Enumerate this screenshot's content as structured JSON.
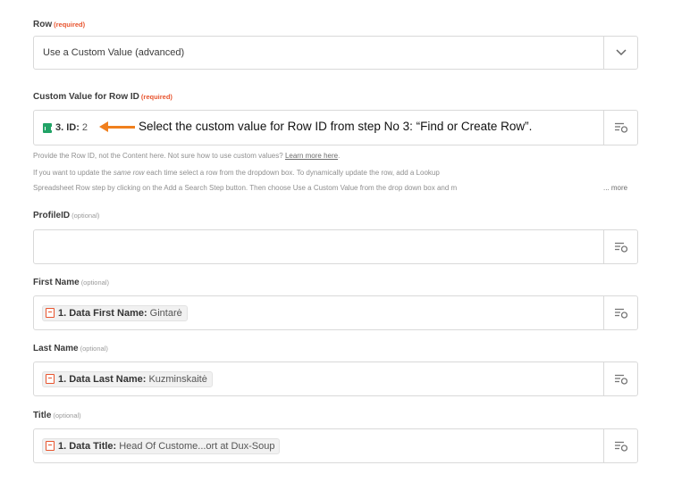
{
  "fields": {
    "row": {
      "label": "Row",
      "tag": "(required)",
      "value": "Use a Custom Value (advanced)",
      "icon": "chevron-down-icon"
    },
    "row_id": {
      "label": "Custom Value for Row ID",
      "tag": "(required)",
      "pill_key": "3. ID:",
      "pill_value": "2",
      "pill_icon": "google-sheets-icon",
      "insert_icon": "insert-data-icon"
    },
    "profile_id": {
      "label": "ProfileID",
      "tag": "(optional)",
      "insert_icon": "insert-data-icon"
    },
    "first_name": {
      "label": "First Name",
      "tag": "(optional)",
      "pill_key": "1. Data First Name:",
      "pill_value": "Gintarė",
      "pill_icon": "dux-soup-icon"
    },
    "last_name": {
      "label": "Last Name",
      "tag": "(optional)",
      "pill_key": "1. Data Last Name:",
      "pill_value": "Kuzminskaitė",
      "pill_icon": "dux-soup-icon"
    },
    "title": {
      "label": "Title",
      "tag": "(optional)",
      "pill_key": "1. Data Title:",
      "pill_value": "Head Of Custome...ort at Dux-Soup",
      "pill_icon": "dux-soup-icon"
    }
  },
  "help": {
    "line1_pre": "Provide the Row ID, not the Content here. Not sure how to use custom values?",
    "line1_link": "Learn more here",
    "line1_post": ".",
    "line2_a": "If you want to update the ",
    "line2_em": "same row",
    "line2_b": " each time select a row from the dropdown box. To dynamically update the row, add a Lookup",
    "line3": "Spreadsheet Row step by clicking on the Add a Search Step button. Then choose Use a Custom Value from the drop down box and m",
    "more": "... more"
  },
  "annotation": {
    "text": "Select the custom value for Row ID from step No 3: “Find or Create Row”.",
    "color": "#f07f1d"
  }
}
